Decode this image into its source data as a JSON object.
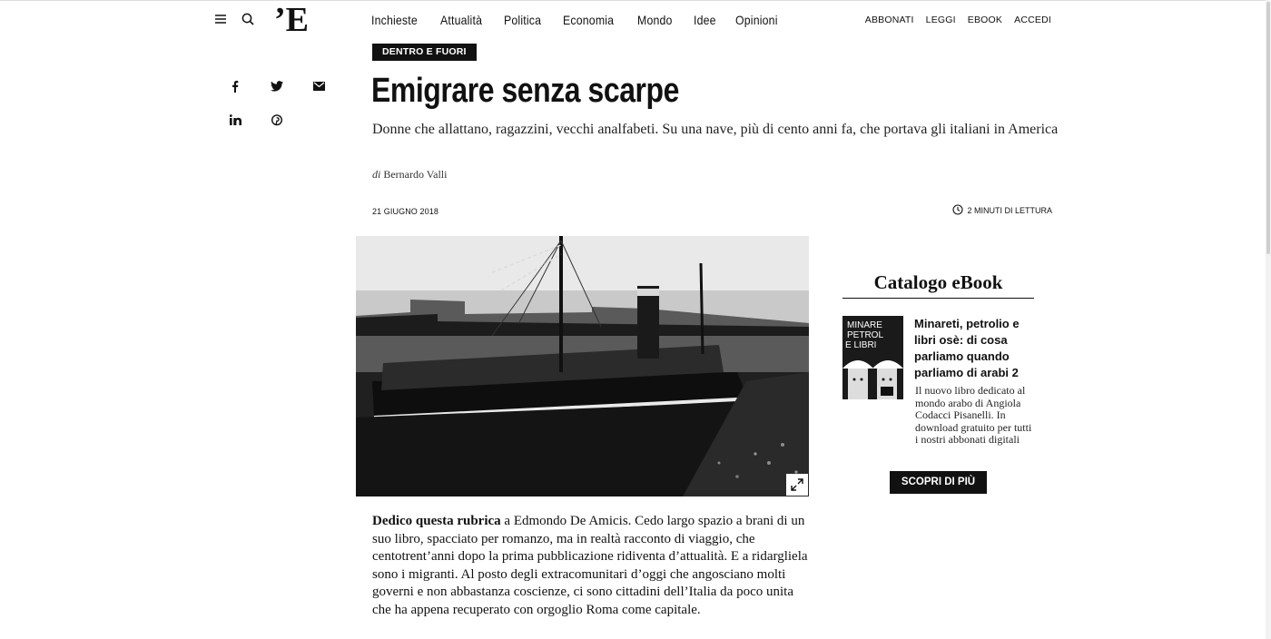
{
  "header": {
    "logo": "’E",
    "nav": [
      "Inchieste",
      "Attualità",
      "Politica",
      "Economia",
      "Mondo",
      "Idee",
      "Opinioni"
    ],
    "right_nav": [
      "ABBONATI",
      "LEGGI",
      "EBOOK",
      "ACCEDI"
    ]
  },
  "share_icons": [
    "facebook-icon",
    "twitter-icon",
    "email-icon",
    "linkedin-icon",
    "pinterest-icon"
  ],
  "article": {
    "category": "DENTRO E FUORI",
    "title": "Emigrare senza scarpe",
    "subtitle": "Donne che allattano, ragazzini, vecchi analfabeti. Su una nave, più di cento anni fa, che portava gli italiani in America",
    "byline_prefix": "di",
    "author": "Bernardo Valli",
    "date": "21 GIUGNO 2018",
    "reading_time": "2 MINUTI DI LETTURA",
    "body_lead": "Dedico questa rubrica",
    "body_rest": " a Edmondo De Amicis. Cedo largo spazio a brani di un suo libro, spacciato per romanzo, ma in realtà racconto di viaggio, che centotrent’anni dopo la prima pubblicazione ridiventa d’attualità. E a ridargliela sono i migranti. Al posto degli extracomunitari d’oggi che angosciano molti governi e non abbastanza coscienze, ci sono cittadini dell’Italia da poco unita che ha appena recuperato con orgoglio Roma come capitale."
  },
  "sidebar": {
    "title": "Catalogo eBook",
    "book_cover_lines": [
      "MINARE",
      "PETROL",
      "E LIBRI"
    ],
    "book_title": "Minareti, petrolio e libri osè: di cosa parliamo quando parliamo di arabi 2",
    "book_desc": "Il nuovo libro dedicato al mondo arabo di Angiola Codacci Pisanelli. In download gratuito per tutti i nostri abbonati digitali",
    "cta": "SCOPRI DI PIÙ"
  },
  "colors": {
    "text": "#111111",
    "background": "#ffffff",
    "label_bg": "#111111"
  }
}
